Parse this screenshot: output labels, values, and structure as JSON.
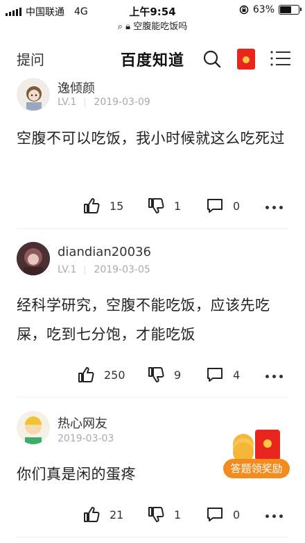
{
  "status_bar": {
    "carrier": "中国联通",
    "network": "4G",
    "time": "上午9:54",
    "battery": "63%",
    "battery_level": 0.63
  },
  "url_bar": {
    "text": "空腹能吃饭吗"
  },
  "nav": {
    "ask_label": "提问",
    "brand": "百度知道"
  },
  "answers": [
    {
      "username": "逸倾颜",
      "level": "LV.1",
      "date": "2019-03-09",
      "content": "空腹不可以吃饭，我小时候就这么吃死过",
      "likes": "15",
      "dislikes": "1",
      "comments": "0"
    },
    {
      "username": "diandian20036",
      "level": "LV.1",
      "date": "2019-03-05",
      "content": "经科学研究，空腹不能吃饭，应该先吃屎，吃到七分饱，才能吃饭",
      "likes": "250",
      "dislikes": "9",
      "comments": "4"
    },
    {
      "username": "热心网友",
      "level": "",
      "date": "2019-03-03",
      "content": "你们真是闲的蛋疼",
      "likes": "21",
      "dislikes": "1",
      "comments": "0"
    }
  ],
  "reward": {
    "label": "答题领奖励"
  },
  "colors": {
    "brand_red": "#e8261d",
    "reward_orange": "#f48b1e",
    "meta_gray": "#aaaaaa"
  }
}
